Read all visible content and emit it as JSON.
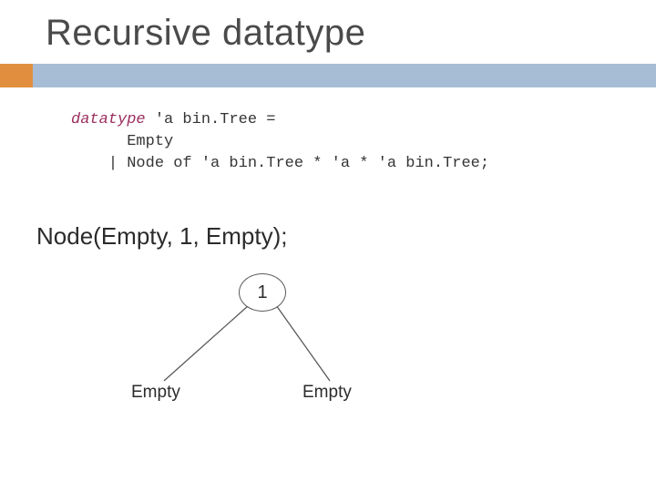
{
  "title": "Recursive datatype",
  "code": {
    "keyword": "datatype",
    "line1_rest": " 'a bin.Tree =",
    "line2": "Empty",
    "line3": "| Node of 'a bin.Tree * 'a * 'a bin.Tree;"
  },
  "example": "Node(Empty, 1, Empty);",
  "tree": {
    "root_label": "1",
    "left_leaf": "Empty",
    "right_leaf": "Empty"
  },
  "colors": {
    "band": "#a7bdd5",
    "accent": "#e18f3f",
    "keyword": "#9a2f5e"
  }
}
